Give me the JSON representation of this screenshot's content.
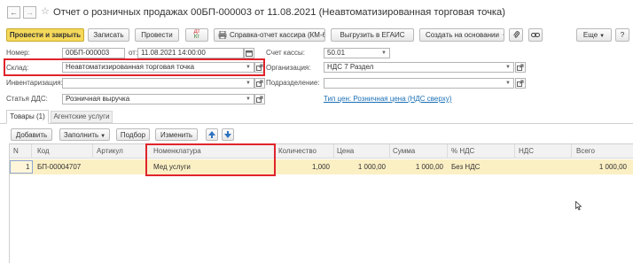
{
  "window": {
    "title": "Отчет о розничных продажах 00БП-000003 от 11.08.2021 (Неавтоматизированная торговая точка)",
    "back_glyph": "←",
    "forward_glyph": "→",
    "star_glyph": "☆"
  },
  "toolbar": {
    "post_close": "Провести и закрыть",
    "save": "Записать",
    "post": "Провести",
    "dt_kt_top": "Дт",
    "dt_kt_bottom": "Кт",
    "cashier_report": "Справка-отчет кассира (КМ-6)",
    "upload_egais": "Выгрузить в ЕГАИС",
    "create_based": "Создать на основании",
    "more": "Еще",
    "help": "?"
  },
  "form": {
    "number_label": "Номер:",
    "number_value": "00БП-000003",
    "from_label": "от:",
    "date_value": "11.08.2021 14:00:00",
    "cash_label": "Счет кассы:",
    "cash_value": "50.01",
    "warehouse_label": "Склад:",
    "warehouse_value": "Неавтоматизированная торговая точка",
    "org_label": "Организация:",
    "org_value": "НДС 7 Раздел",
    "inventory_label": "Инвентаризация:",
    "inventory_value": "",
    "division_label": "Подразделение:",
    "division_value": "",
    "dds_label": "Статья ДДС:",
    "dds_value": "Розничная выручка",
    "price_type_link": "Тип цен: Розничная цена (НДС сверху)"
  },
  "tabs": [
    {
      "label": "Товары (1)",
      "active": true
    },
    {
      "label": "Агентские услуги",
      "active": false
    }
  ],
  "table_toolbar": {
    "add": "Добавить",
    "fill": "Заполнить",
    "selection": "Подбор",
    "change": "Изменить"
  },
  "table": {
    "columns": [
      "N",
      "Код",
      "Артикул",
      "Номенклатура",
      "Количество",
      "Цена",
      "Сумма",
      "% НДС",
      "НДС",
      "Всего"
    ],
    "rows": [
      [
        "1",
        "БП-00004707",
        "",
        "Мед услуги",
        "1,000",
        "1 000,00",
        "1 000,00",
        "Без НДС",
        "",
        "1 000,00"
      ]
    ]
  },
  "colors": {
    "primary_button": "#f5d95a",
    "highlight_frame": "#e0242b",
    "selected_row": "#fbefc4",
    "link": "#1a6fb5"
  }
}
